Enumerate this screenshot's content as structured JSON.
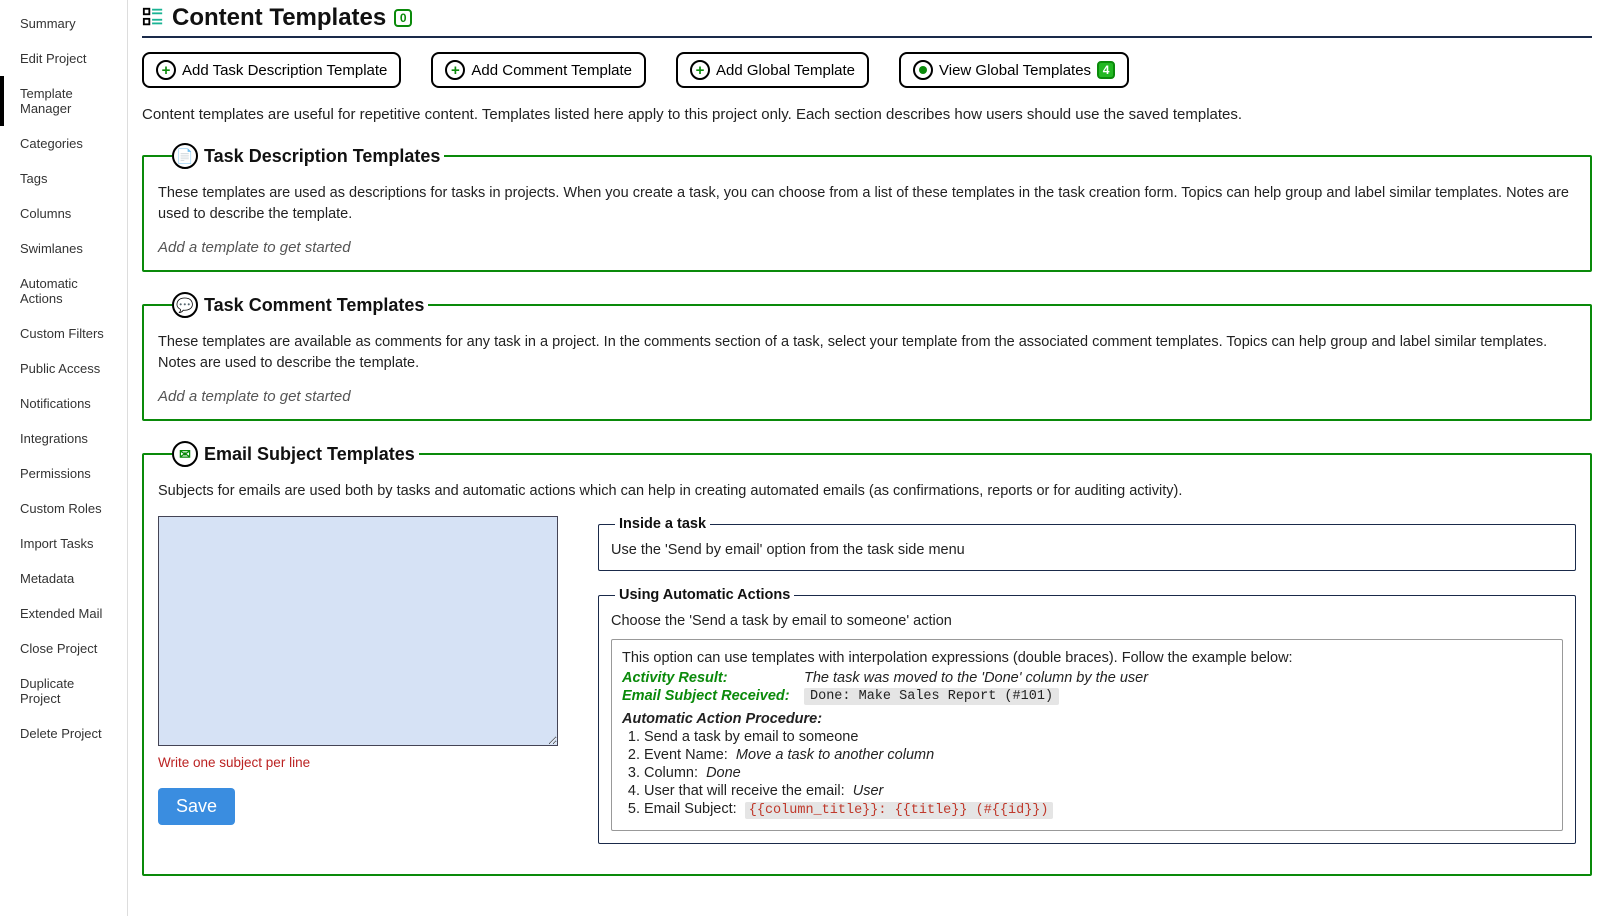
{
  "sidebar": {
    "items": [
      {
        "label": "Summary"
      },
      {
        "label": "Edit Project"
      },
      {
        "label": "Template Manager"
      },
      {
        "label": "Categories"
      },
      {
        "label": "Tags"
      },
      {
        "label": "Columns"
      },
      {
        "label": "Swimlanes"
      },
      {
        "label": "Automatic Actions"
      },
      {
        "label": "Custom Filters"
      },
      {
        "label": "Public Access"
      },
      {
        "label": "Notifications"
      },
      {
        "label": "Integrations"
      },
      {
        "label": "Permissions"
      },
      {
        "label": "Custom Roles"
      },
      {
        "label": "Import Tasks"
      },
      {
        "label": "Metadata"
      },
      {
        "label": "Extended Mail"
      },
      {
        "label": "Close Project"
      },
      {
        "label": "Duplicate Project"
      },
      {
        "label": "Delete Project"
      }
    ],
    "active_index": 2
  },
  "header": {
    "title": "Content Templates",
    "count": "0"
  },
  "toolbar": {
    "add_task_desc": "Add Task Description Template",
    "add_comment": "Add Comment Template",
    "add_global": "Add Global Template",
    "view_global": "View Global Templates",
    "global_count": "4"
  },
  "intro": "Content templates are useful for repetitive content. Templates listed here apply to this project only. Each section describes how users should use the saved templates.",
  "sections": {
    "task_desc": {
      "title": "Task Description Templates",
      "desc": "These templates are used as descriptions for tasks in projects. When you create a task, you can choose from a list of these templates in the task creation form. Topics can help group and label similar templates. Notes are used to describe the template.",
      "empty": "Add a template to get started"
    },
    "task_comment": {
      "title": "Task Comment Templates",
      "desc": "These templates are available as comments for any task in a project. In the comments section of a task, select your template from the associated comment templates. Topics can help group and label similar templates. Notes are used to describe the template.",
      "empty": "Add a template to get started"
    },
    "email": {
      "title": "Email Subject Templates",
      "desc": "Subjects for emails are used both by tasks and automatic actions which can help in creating automated emails (as confirmations, reports or for auditing activity).",
      "hint": "Write one subject per line",
      "save": "Save",
      "inside_task": {
        "legend": "Inside a task",
        "text": "Use the 'Send by email' option from the task side menu"
      },
      "automatic": {
        "legend": "Using Automatic Actions",
        "text": "Choose the 'Send a task by email to someone' action",
        "info_intro": "This option can use templates with interpolation expressions (double braces). Follow the example below:",
        "activity_result_label": "Activity Result:",
        "activity_result_val": "The task was moved to the 'Done' column by the user",
        "subject_received_label": "Email Subject Received:",
        "subject_received_val": "Done: Make Sales Report (#101)",
        "procedure_header": "Automatic Action Procedure:",
        "steps": {
          "s1": "Send a task by email to someone",
          "s2_pre": "Event Name:",
          "s2_val": "Move a task to another column",
          "s3_pre": "Column:",
          "s3_val": "Done",
          "s4_pre": "User that will receive the email:",
          "s4_val": "User",
          "s5_pre": "Email Subject:",
          "s5_code": "{{column_title}}: {{title}} (#{{id}})"
        }
      }
    }
  }
}
